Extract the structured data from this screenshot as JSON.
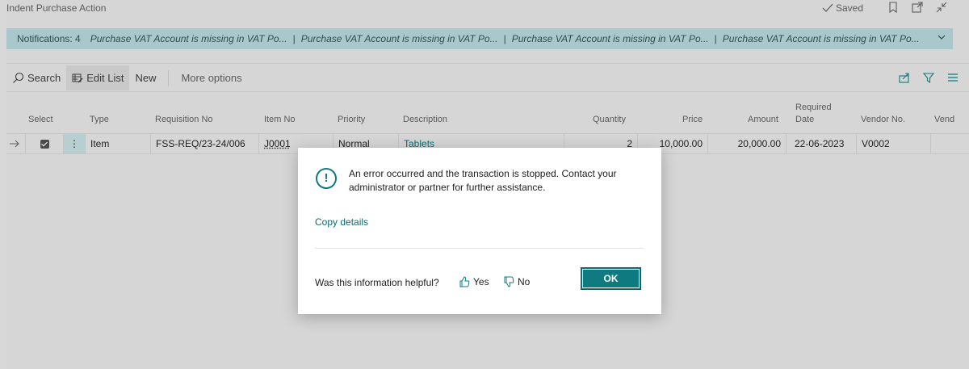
{
  "header": {
    "title": "Indent Purchase Action",
    "saved_label": "Saved"
  },
  "notifications": {
    "count_label": "Notifications: 4",
    "messages": [
      "Purchase VAT Account is missing in VAT Po...",
      "Purchase VAT Account is missing in VAT Po...",
      "Purchase VAT Account is missing in VAT Po...",
      "Purchase VAT Account is missing in VAT Po..."
    ],
    "separator": "|"
  },
  "toolbar": {
    "search_label": "Search",
    "edit_list_label": "Edit List",
    "new_label": "New",
    "more_options_label": "More options"
  },
  "grid": {
    "columns": {
      "select": "Select",
      "type": "Type",
      "requisition_no": "Requisition No",
      "item_no": "Item No",
      "priority": "Priority",
      "description": "Description",
      "quantity": "Quantity",
      "price": "Price",
      "amount": "Amount",
      "required_date_1": "Required",
      "required_date_2": "Date",
      "vendor_no": "Vendor No.",
      "vendor_name": "Vend"
    },
    "row": {
      "type": "Item",
      "requisition_no": "FSS-REQ/23-24/006",
      "item_no": "J0001",
      "priority": "Normal",
      "description": "Tablets",
      "quantity": "2",
      "price": "10,000.00",
      "amount": "20,000.00",
      "required_date": "22-06-2023",
      "vendor_no": "V0002"
    }
  },
  "dialog": {
    "icon": "!",
    "message": "An error occurred and the transaction is stopped. Contact your administrator or partner for further assistance.",
    "copy_details": "Copy details",
    "helpful_question": "Was this information helpful?",
    "yes_label": "Yes",
    "no_label": "No",
    "ok_label": "OK"
  },
  "colors": {
    "accent": "#0f7a80",
    "notification_bg": "#a9c8cb"
  }
}
